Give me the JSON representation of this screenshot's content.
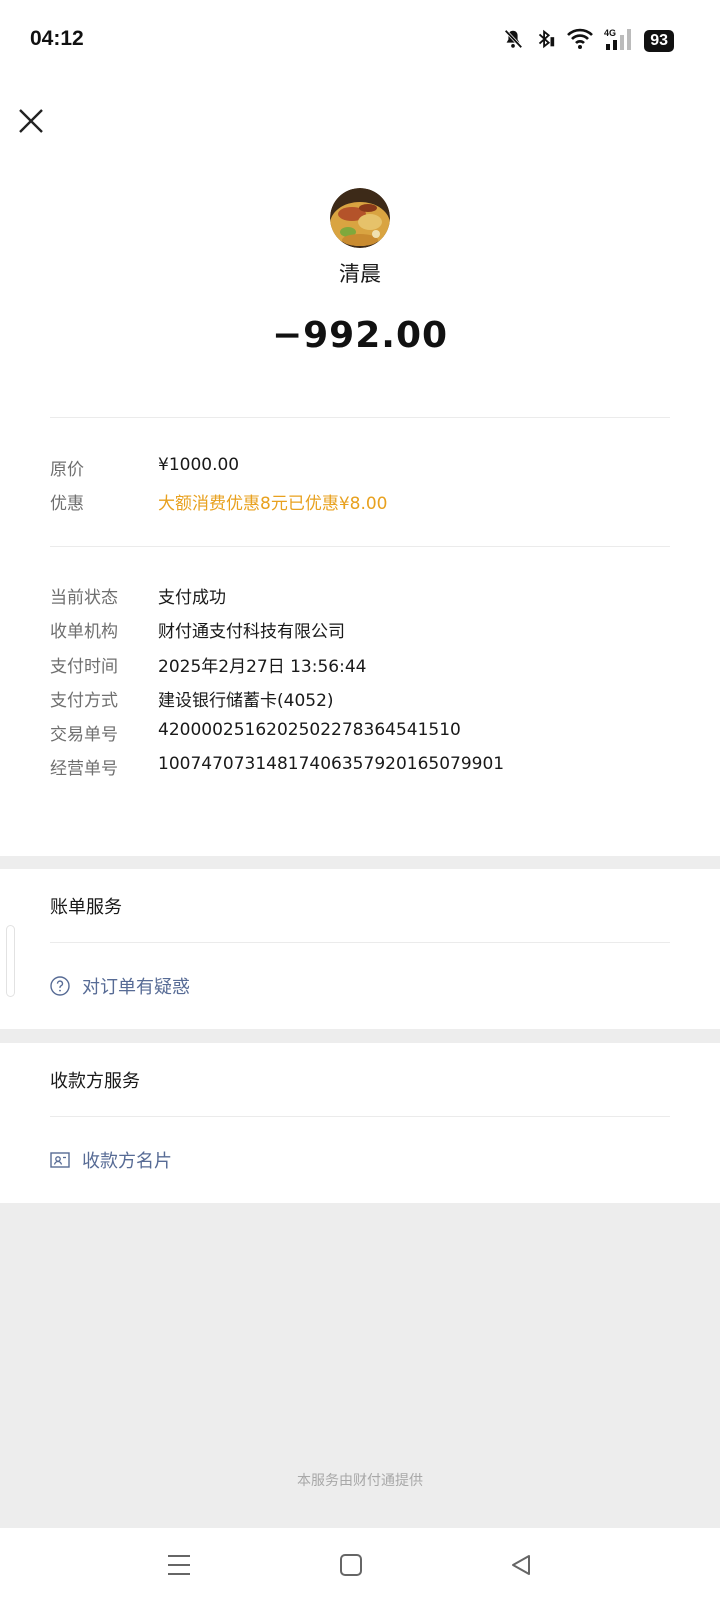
{
  "status_bar": {
    "time": "04:12",
    "battery": "93",
    "icons": [
      "bell-off-icon",
      "bluetooth-icon",
      "wifi-icon",
      "signal-4g-icon"
    ]
  },
  "header": {
    "close_icon": "close-icon"
  },
  "transaction": {
    "merchant": "清晨",
    "amount": "−992.00"
  },
  "pricing": [
    {
      "label": "原价",
      "value": "¥1000.00"
    },
    {
      "label": "优惠",
      "value": "大额消费优惠8元已优惠¥8.00"
    }
  ],
  "details": [
    {
      "label": "当前状态",
      "value": "支付成功"
    },
    {
      "label": "收单机构",
      "value": "财付通支付科技有限公司"
    },
    {
      "label": "支付时间",
      "value": "2025年2月27日 13:56:44"
    },
    {
      "label": "支付方式",
      "value": "建设银行储蓄卡(4052)"
    },
    {
      "label": "交易单号",
      "value": "4200002516202502278364541510"
    },
    {
      "label": "经营单号",
      "value": "10074707314817406357920165079901"
    }
  ],
  "bill_service": {
    "title": "账单服务",
    "link": "对订单有疑惑"
  },
  "payee_service": {
    "title": "收款方服务",
    "link": "收款方名片"
  },
  "footer": {
    "note": "本服务由财付通提供"
  },
  "colors": {
    "discount": "#e8a11f",
    "link": "#576b95",
    "background": "#ededed"
  }
}
